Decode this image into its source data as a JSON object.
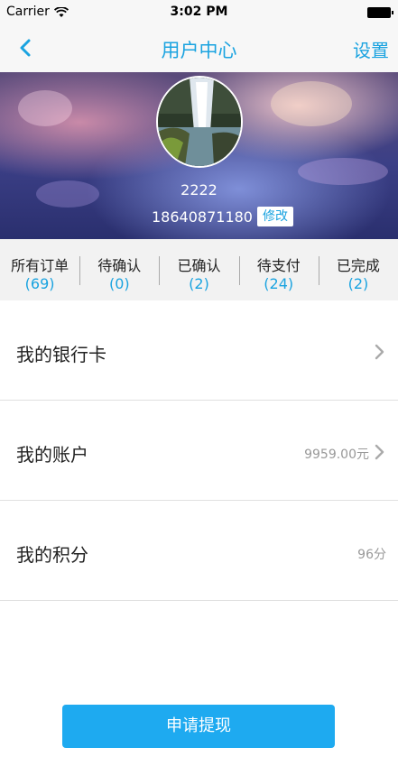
{
  "status_bar": {
    "carrier": "Carrier",
    "time": "3:02 PM"
  },
  "navbar": {
    "title": "用户中心",
    "settings_label": "设置"
  },
  "profile": {
    "username": "2222",
    "phone": "18640871180",
    "edit_label": "修改"
  },
  "orders": [
    {
      "label": "所有订单",
      "count": "(69)"
    },
    {
      "label": "待确认",
      "count": "(0)"
    },
    {
      "label": "已确认",
      "count": "(2)"
    },
    {
      "label": "待支付",
      "count": "(24)"
    },
    {
      "label": "已完成",
      "count": "(2)"
    }
  ],
  "menu": [
    {
      "label": "我的银行卡",
      "value": ""
    },
    {
      "label": "我的账户",
      "value": "9959.00元"
    },
    {
      "label": "我的积分",
      "value": "96分"
    }
  ],
  "withdraw_label": "申请提现",
  "colors": {
    "accent": "#1aa3e0",
    "button": "#1eaaf0"
  }
}
